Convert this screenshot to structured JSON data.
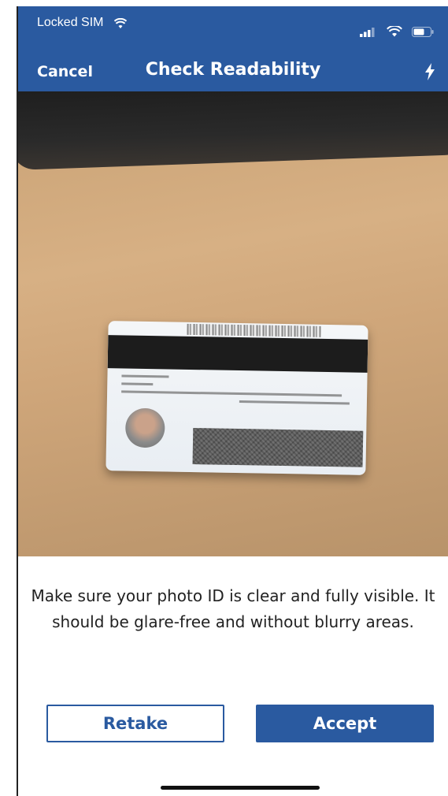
{
  "status_bar": {
    "carrier": "Locked SIM"
  },
  "nav": {
    "cancel_label": "Cancel",
    "title": "Check Readability",
    "flash_icon": "flash-icon"
  },
  "instructions": {
    "text": "Make sure your photo ID is clear and fully visible. It should be glare-free and without blurry areas."
  },
  "actions": {
    "retake_label": "Retake",
    "accept_label": "Accept"
  },
  "colors": {
    "brand_blue": "#2a5aa0",
    "text_dark": "#222222",
    "background": "#ffffff"
  }
}
